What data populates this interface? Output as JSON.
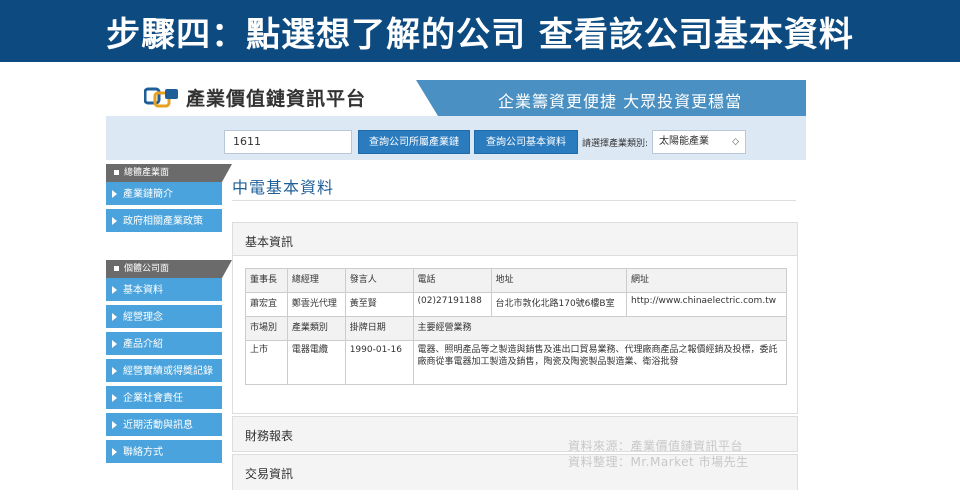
{
  "banner": {
    "title": "步驟四：點選想了解的公司 查看該公司基本資料"
  },
  "header": {
    "site_name": "產業價值鏈資訊平台",
    "slogan": "企業籌資更便捷 大眾投資更穩當"
  },
  "search": {
    "stock_code": "1611",
    "btn_industry_chain": "查詢公司所屬產業鏈",
    "btn_basic_info": "查詢公司基本資料",
    "category_label": "請選擇產業類別:",
    "category_value": "太陽能產業"
  },
  "sidebar": {
    "section1": "總體產業面",
    "section1_items": [
      "產業鏈簡介",
      "政府相關產業政策"
    ],
    "section2": "個體公司面",
    "section2_items": [
      "基本資料",
      "經營理念",
      "產品介紹",
      "經營實績或得獎記錄",
      "企業社會責任",
      "近期活動與訊息",
      "聯絡方式"
    ]
  },
  "main": {
    "company_title": "中電基本資料",
    "panel_basic": "基本資訊",
    "panel_finance": "財務報表",
    "panel_trade": "交易資訊",
    "table": {
      "h1": "董事長",
      "h2": "總經理",
      "h3": "發言人",
      "h4": "電話",
      "h5": "地址",
      "h6": "網址",
      "chairman": "蕭宏宜",
      "gm": "鄭雲光代理",
      "spokesman": "黃至賢",
      "phone": "(02)27191188",
      "address": "台北市敦化北路170號6樓B室",
      "website": "http://www.chinaelectric.com.tw",
      "h7": "市場別",
      "h8": "產業類別",
      "h9": "掛牌日期",
      "h10": "主要經營業務",
      "market": "上市",
      "industry": "電器電纜",
      "listing_date": "1990-01-16",
      "business": "電器、照明產品等之製造與銷售及進出口貿易業務、代理廠商產品之報價經銷及投標，委託廠商從事電器加工製造及銷售，陶瓷及陶瓷製品製造業、衛浴批發"
    }
  },
  "footer": {
    "source": "資料來源：產業價值鏈資訊平台",
    "compiled": "資料整理：Mr.Market 市場先生"
  }
}
